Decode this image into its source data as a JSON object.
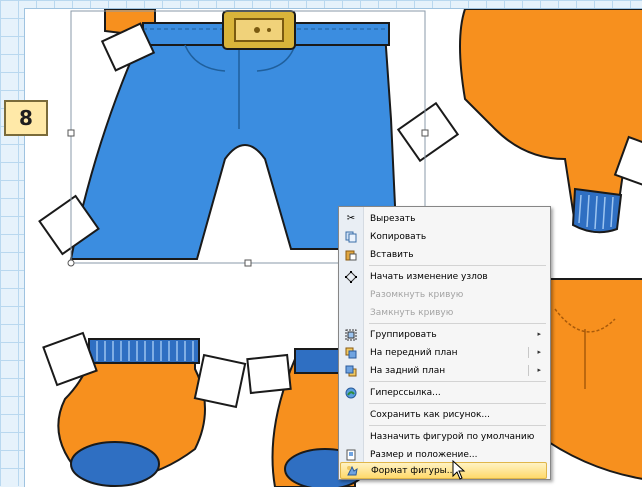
{
  "step_badge": "8",
  "context_menu": {
    "items": [
      {
        "label": "Вырезать",
        "icon": "scissors-icon",
        "enabled": true
      },
      {
        "label": "Копировать",
        "icon": "copy-icon",
        "enabled": true
      },
      {
        "label": "Вставить",
        "icon": "paste-icon",
        "enabled": true
      },
      {
        "label": "Начать изменение узлов",
        "icon": "edit-points-icon",
        "enabled": true
      },
      {
        "label": "Разомкнуть кривую",
        "enabled": false
      },
      {
        "label": "Замкнуть кривую",
        "enabled": false
      },
      {
        "label": "Группировать",
        "icon": "group-icon",
        "enabled": true,
        "submenu": true
      },
      {
        "label": "На передний план",
        "icon": "bring-front-icon",
        "enabled": true,
        "submenu": true
      },
      {
        "label": "На задний план",
        "icon": "send-back-icon",
        "enabled": true,
        "submenu": true
      },
      {
        "label": "Гиперссылка...",
        "icon": "hyperlink-icon",
        "enabled": true
      },
      {
        "label": "Сохранить как рисунок...",
        "enabled": true
      },
      {
        "label": "Назначить фигурой по умолчанию",
        "enabled": true
      },
      {
        "label": "Размер и положение...",
        "icon": "size-position-icon",
        "enabled": true
      },
      {
        "label": "Формат фигуры...",
        "icon": "format-shape-icon",
        "enabled": true,
        "highlighted": true
      }
    ],
    "submenu_arrow": "▸"
  },
  "colors": {
    "jeans": "#3b8de0",
    "orange": "#f7901e",
    "belt": "#d9b43a",
    "outline": "#1a1a1a",
    "menu_highlight": "#ffd96b"
  }
}
